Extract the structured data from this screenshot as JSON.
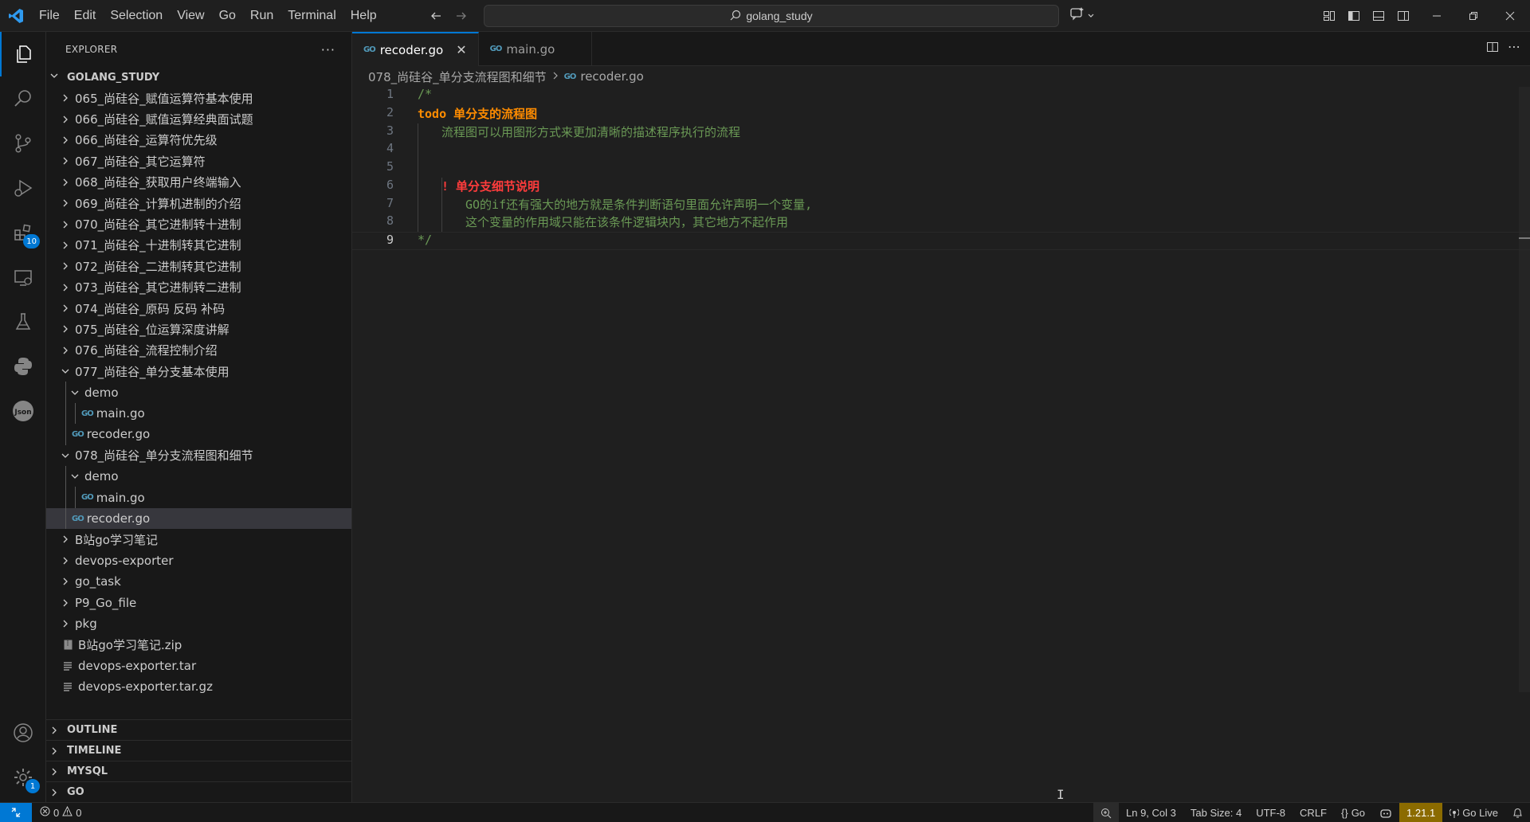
{
  "menu": [
    "File",
    "Edit",
    "Selection",
    "View",
    "Go",
    "Run",
    "Terminal",
    "Help"
  ],
  "search": {
    "text": "golang_study"
  },
  "sidebar": {
    "title": "EXPLORER",
    "more": "···",
    "root": "GOLANG_STUDY",
    "tree": [
      {
        "label": "065_尚硅谷_赋值运算符基本使用",
        "type": "folder",
        "depth": 1,
        "open": false
      },
      {
        "label": "066_尚硅谷_赋值运算经典面试题",
        "type": "folder",
        "depth": 1,
        "open": false
      },
      {
        "label": "066_尚硅谷_运算符优先级",
        "type": "folder",
        "depth": 1,
        "open": false
      },
      {
        "label": "067_尚硅谷_其它运算符",
        "type": "folder",
        "depth": 1,
        "open": false
      },
      {
        "label": "068_尚硅谷_获取用户终端输入",
        "type": "folder",
        "depth": 1,
        "open": false
      },
      {
        "label": "069_尚硅谷_计算机进制的介绍",
        "type": "folder",
        "depth": 1,
        "open": false
      },
      {
        "label": "070_尚硅谷_其它进制转十进制",
        "type": "folder",
        "depth": 1,
        "open": false
      },
      {
        "label": "071_尚硅谷_十进制转其它进制",
        "type": "folder",
        "depth": 1,
        "open": false
      },
      {
        "label": "072_尚硅谷_二进制转其它进制",
        "type": "folder",
        "depth": 1,
        "open": false
      },
      {
        "label": "073_尚硅谷_其它进制转二进制",
        "type": "folder",
        "depth": 1,
        "open": false
      },
      {
        "label": "074_尚硅谷_原码 反码 补码",
        "type": "folder",
        "depth": 1,
        "open": false
      },
      {
        "label": "075_尚硅谷_位运算深度讲解",
        "type": "folder",
        "depth": 1,
        "open": false
      },
      {
        "label": "076_尚硅谷_流程控制介绍",
        "type": "folder",
        "depth": 1,
        "open": false
      },
      {
        "label": "077_尚硅谷_单分支基本使用",
        "type": "folder",
        "depth": 1,
        "open": true
      },
      {
        "label": "demo",
        "type": "folder",
        "depth": 2,
        "open": true
      },
      {
        "label": "main.go",
        "type": "go",
        "depth": 3
      },
      {
        "label": "recoder.go",
        "type": "go",
        "depth": 2
      },
      {
        "label": "078_尚硅谷_单分支流程图和细节",
        "type": "folder",
        "depth": 1,
        "open": true
      },
      {
        "label": "demo",
        "type": "folder",
        "depth": 2,
        "open": true
      },
      {
        "label": "main.go",
        "type": "go",
        "depth": 3
      },
      {
        "label": "recoder.go",
        "type": "go",
        "depth": 2,
        "selected": true
      },
      {
        "label": "B站go学习笔记",
        "type": "folder",
        "depth": 1,
        "open": false
      },
      {
        "label": "devops-exporter",
        "type": "folder",
        "depth": 1,
        "open": false
      },
      {
        "label": "go_task",
        "type": "folder",
        "depth": 1,
        "open": false
      },
      {
        "label": "P9_Go_file",
        "type": "folder",
        "depth": 1,
        "open": false
      },
      {
        "label": "pkg",
        "type": "folder",
        "depth": 1,
        "open": false
      },
      {
        "label": "B站go学习笔记.zip",
        "type": "zip",
        "depth": 1
      },
      {
        "label": "devops-exporter.tar",
        "type": "text",
        "depth": 1
      },
      {
        "label": "devops-exporter.tar.gz",
        "type": "text",
        "depth": 1
      }
    ],
    "sections": [
      "OUTLINE",
      "TIMELINE",
      "MYSQL",
      "GO"
    ]
  },
  "activity": {
    "extensions_badge": "10",
    "settings_badge": "1"
  },
  "tabs": [
    {
      "label": "recoder.go",
      "active": true
    },
    {
      "label": "main.go",
      "active": false
    }
  ],
  "breadcrumb": {
    "folder": "078_尚硅谷_单分支流程图和细节",
    "file": "recoder.go"
  },
  "code": [
    {
      "n": "1",
      "text": "/*",
      "kind": "comment",
      "indent": 0
    },
    {
      "n": "2",
      "text": "todo 单分支的流程图",
      "kind": "todo",
      "indent": 0
    },
    {
      "n": "3",
      "text": "流程图可以用图形方式来更加清晰的描述程序执行的流程",
      "kind": "comment",
      "indent": 1
    },
    {
      "n": "4",
      "text": "",
      "kind": "comment",
      "indent": 0
    },
    {
      "n": "5",
      "text": "",
      "kind": "comment",
      "indent": 0
    },
    {
      "n": "6",
      "text": "! 单分支细节说明",
      "kind": "warn",
      "indent": 1
    },
    {
      "n": "7",
      "text": "GO的if还有强大的地方就是条件判断语句里面允许声明一个变量,",
      "kind": "comment",
      "indent": 2
    },
    {
      "n": "8",
      "text": "这个变量的作用域只能在该条件逻辑块内，其它地方不起作用",
      "kind": "comment",
      "indent": 2
    },
    {
      "n": "9",
      "text": "*/",
      "kind": "comment",
      "indent": 0,
      "current": true
    }
  ],
  "status": {
    "errors": "0",
    "warnings": "0",
    "position": "Ln 9, Col 3",
    "tab_size": "Tab Size: 4",
    "encoding": "UTF-8",
    "eol": "CRLF",
    "language": "Go",
    "version": "1.21.1",
    "live": "Go Live"
  },
  "colors": {
    "accent": "#0078d4",
    "comment": "#6a9955",
    "todo": "#ff8c00",
    "warn": "#ff3c3c",
    "go_icon": "#519aba",
    "version_bg": "#8b6b00"
  }
}
